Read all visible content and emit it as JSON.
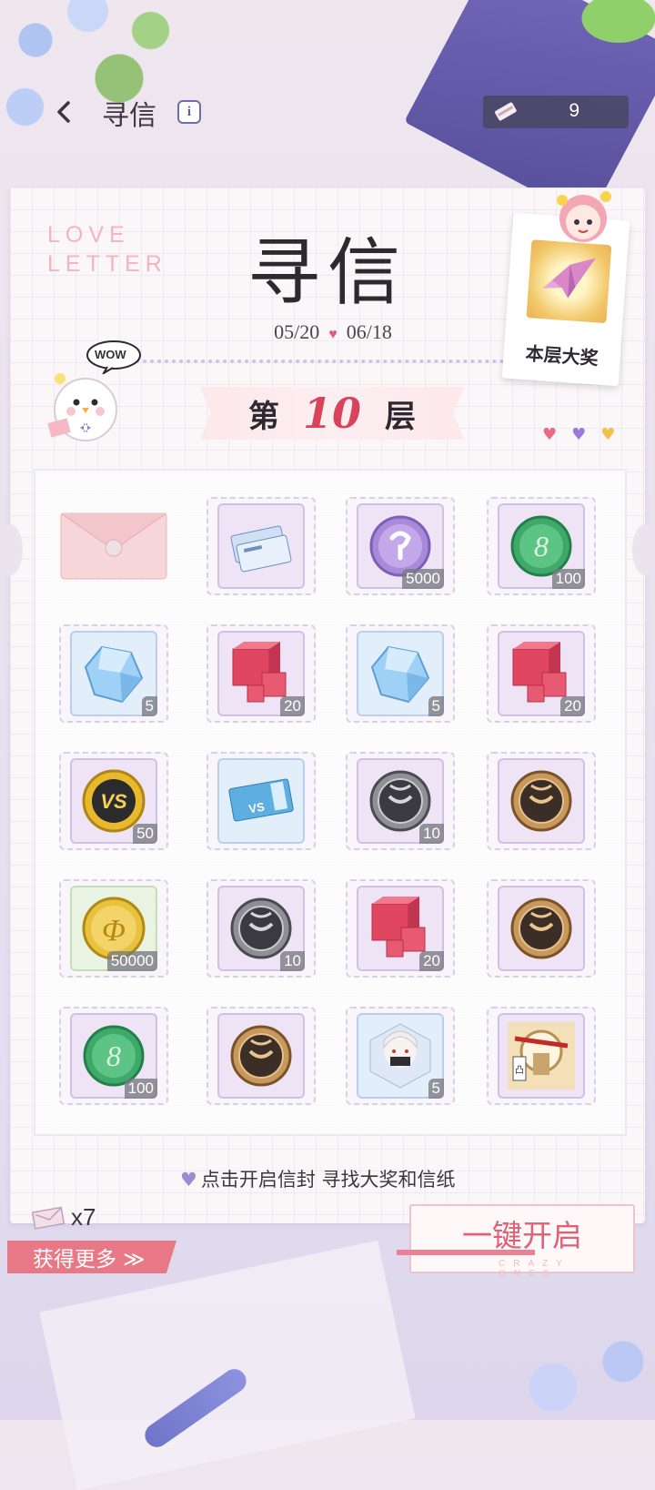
{
  "header": {
    "title": "寻信",
    "info_glyph": "i",
    "currency_value": "9"
  },
  "event": {
    "deco_title_line1": "LOVE",
    "deco_title_line2": "LETTER",
    "big_title": "寻信",
    "start_date": "05/20",
    "end_date": "06/18",
    "mascot_bubble": "WOW"
  },
  "prize_card": {
    "label": "本层大奖"
  },
  "floor": {
    "prefix": "第",
    "number": "10",
    "suffix": "层"
  },
  "grid": [
    [
      {
        "kind": "envelope",
        "count": ""
      },
      {
        "kind": "pass-cards",
        "count": ""
      },
      {
        "kind": "purple-coin",
        "count": "5000"
      },
      {
        "kind": "green-coin",
        "count": "100"
      }
    ],
    [
      {
        "kind": "blue-crystal",
        "count": "5"
      },
      {
        "kind": "red-cubes",
        "count": "20"
      },
      {
        "kind": "blue-crystal",
        "count": "5"
      },
      {
        "kind": "red-cubes",
        "count": "20"
      }
    ],
    [
      {
        "kind": "vs-coin",
        "count": "50"
      },
      {
        "kind": "vs-ticket",
        "count": ""
      },
      {
        "kind": "silver-medal",
        "count": "10"
      },
      {
        "kind": "bronze-medal",
        "count": ""
      }
    ],
    [
      {
        "kind": "gold-coin",
        "count": "50000"
      },
      {
        "kind": "silver-medal",
        "count": "10"
      },
      {
        "kind": "red-cubes",
        "count": "20"
      },
      {
        "kind": "bronze-medal",
        "count": ""
      }
    ],
    [
      {
        "kind": "green-coin",
        "count": "100"
      },
      {
        "kind": "bronze-medal",
        "count": ""
      },
      {
        "kind": "character-portrait",
        "count": "5"
      },
      {
        "kind": "dragon-frame",
        "count": ""
      }
    ]
  ],
  "hint": "点击开启信封  寻找大奖和信纸",
  "letters": {
    "count_label": "x7"
  },
  "get_more_label": "获得更多 ≫",
  "open_all": {
    "label": "一键开启",
    "sub": "CRAZY ONES"
  },
  "colors": {
    "accent_pink": "#e06076",
    "floor_number": "#d9445d",
    "purple_frame": "#cfc1e6",
    "blue_frame": "#b8d0ee",
    "green_frame": "#c5dfb4"
  },
  "icons": {
    "back": "chevron-left-icon",
    "info": "info-icon",
    "currency": "letter-scroll-icon",
    "prize": "paper-crane-icon"
  }
}
